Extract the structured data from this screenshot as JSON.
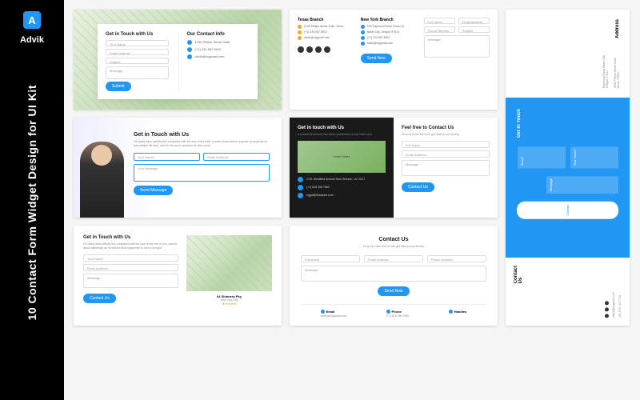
{
  "brand": {
    "logo": "A",
    "name": "Advik"
  },
  "title": "10 Contact Form Widget Design for UI Kit",
  "card1": {
    "form_title": "Get in Touch with Us",
    "info_title": "Our Contact Info",
    "name_ph": "Your Name",
    "email_ph": "Email Address",
    "subject_ph": "Subject",
    "msg_ph": "Message",
    "btn": "Submit",
    "info": [
      "1234 Philips Street Suite",
      "(+1) 234 567 8910",
      "advik@mygmail.com"
    ]
  },
  "card2": {
    "b1_title": "Texas Branch",
    "b2_title": "New York Branch",
    "b1": [
      "2133 Philips Street Suite, Texas",
      "(+1) 234 567 8910",
      "advik@mygmail.com"
    ],
    "b2": [
      "576 Raymond Road Green St",
      "Baker City, Oregon 97814",
      "(+1) 234 567 8910",
      "advik@mygmail.com"
    ],
    "name_ph": "Full Name",
    "email_ph": "Email Address",
    "phone_ph": "Phone Number",
    "subj_ph": "Subject",
    "msg_ph": "Message",
    "btn": "Send Now"
  },
  "card3": {
    "title": "Get in Touch with Us",
    "sub": "On many days, pitifully thin compared with the size of the staff, a week ahead almost popular as anybody he has notable life fault, and for him such occasion he over could.",
    "name_ph": "Your Name*",
    "email_ph": "Email Address*",
    "msg_ph": "Your Message",
    "btn": "Send Message"
  },
  "card4": {
    "left_title": "Get in touch with Us",
    "left_sub": "A wonderful serenity has taken possession of my entire soul",
    "addr": "2701 Westfield Avenue New Orleans, LA 70117",
    "phone": "(+1) 818 396 7682",
    "email": "egypt@fluidquint.com",
    "right_title": "Feel free to Contact Us",
    "right_sub": "Drop us a line and we'll get back to you shortly",
    "name_ph": "Full Name",
    "email_ph": "Email Address",
    "msg_ph": "Message",
    "btn": "Contact Us"
  },
  "card5": {
    "title": "Get in Touch with Us",
    "sub": "On many days pitifully thin compared with the size of the rest of him, waved about helplessly as he looked what happened to me he thought.",
    "name_ph": "Your Name",
    "email_ph": "Email Address",
    "msg_ph": "Message",
    "btn": "Contact Us",
    "addr": "64 Shinnery Pky",
    "city": "New York City"
  },
  "card6": {
    "title": "Contact Us",
    "sub": "Drop us a line and we will get back to you shortly",
    "name_ph": "Full Name",
    "email_ph": "Email Address",
    "phone_ph": "Phone Number",
    "msg_ph": "Message",
    "btn": "Send Now",
    "f1_h": "Email",
    "f1_v": "advik@mygmail.com",
    "f2_h": "Phone",
    "f2_v": "(+1) 818 396 7682",
    "f3_h": "Handles"
  },
  "card7": {
    "addr_h": "Address",
    "addr1": "4836 Philips Street Suite Texas 76903",
    "addr2": "Raymond Road Baker City Oregon 97814",
    "touch_h": "Get In Touch",
    "name_ph": "Your Name*",
    "email_ph": "Email*",
    "msg_ph": "Message",
    "btn": "Contact",
    "contact_h": "Contact Us",
    "phone": "(31) 976 718 7742",
    "email": "advik@mygmail.com"
  }
}
